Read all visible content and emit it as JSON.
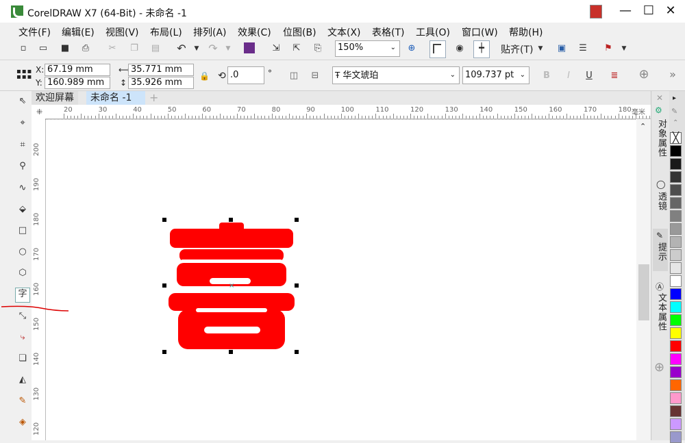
{
  "window": {
    "title": "CorelDRAW X7 (64-Bit) - 未命名 -1",
    "minimize": "—",
    "maximize": "☐",
    "close": "✕"
  },
  "menu": [
    "文件(F)",
    "编辑(E)",
    "视图(V)",
    "布局(L)",
    "排列(A)",
    "效果(C)",
    "位图(B)",
    "文本(X)",
    "表格(T)",
    "工具(O)",
    "窗口(W)",
    "帮助(H)"
  ],
  "toolbar": {
    "zoom_value": "150%",
    "snap_label": "贴齐(T)",
    "icons": [
      "new-icon",
      "open-icon",
      "save-icon",
      "print-icon",
      "cut-icon",
      "copy-icon",
      "paste-icon",
      "undo-icon",
      "redo-icon",
      "search-content-icon",
      "import-icon",
      "export-icon",
      "publish-pdf-icon",
      "zoom-level-icon",
      "full-screen-icon",
      "rulers-icon",
      "view-icon",
      "guidelines-icon",
      "options-icon",
      "app-launcher-icon",
      "welcome-screen-icon"
    ]
  },
  "property_bar": {
    "x_label": "X:",
    "x_value": "67.19 mm",
    "y_label": "Y:",
    "y_value": "160.989 mm",
    "width_value": "35.771 mm",
    "height_value": "35.926 mm",
    "rotation_value": ".0",
    "degree": "°",
    "font_name": "华文琥珀",
    "font_size": "109.737 pt",
    "more": "»"
  },
  "tabs": {
    "welcome": "欢迎屏幕",
    "document": "未命名 -1",
    "add": "+"
  },
  "ruler": {
    "top_ticks": [
      "20",
      "30",
      "40",
      "50",
      "60",
      "70",
      "80",
      "90",
      "100",
      "110",
      "120",
      "130",
      "140",
      "150",
      "160",
      "170",
      "180"
    ],
    "unit": "毫米",
    "left_ticks": [
      "200",
      "190",
      "180",
      "170",
      "160",
      "150",
      "140",
      "130",
      "120"
    ]
  },
  "docker_tabs": [
    "对象属性",
    "透镜",
    "提示",
    "文本属性"
  ],
  "tools": [
    "pick-tool",
    "shape-tool",
    "crop-tool",
    "zoom-tool",
    "freehand-tool",
    "smart-fill-tool",
    "rectangle-tool",
    "ellipse-tool",
    "polygon-tool",
    "text-tool",
    "parallel-dimension-tool",
    "connector-tool",
    "drop-shadow-tool",
    "transparency-tool",
    "color-eyedropper-tool",
    "interactive-fill-tool"
  ],
  "text_tool_glyph": "字",
  "palette": [
    "#000000",
    "#1a1a1a",
    "#333333",
    "#4d4d4d",
    "#666666",
    "#808080",
    "#999999",
    "#b3b3b3",
    "#cccccc",
    "#e6e6e6",
    "#ffffff",
    "#0000ff",
    "#00ffff",
    "#00ff00",
    "#ffff00",
    "#ff0000",
    "#ff00ff",
    "#9900cc",
    "#ff6600",
    "#ff99cc",
    "#663333",
    "#cc99ff",
    "#9999cc"
  ],
  "accent_red": "#ff0000"
}
